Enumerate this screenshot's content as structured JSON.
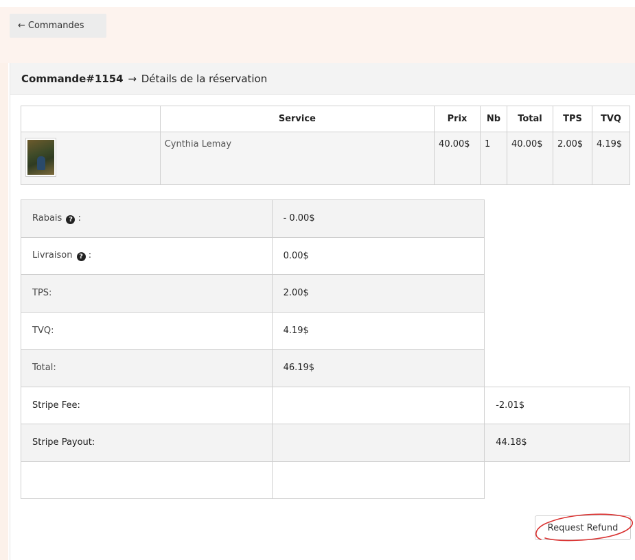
{
  "nav": {
    "back_arrow": "←",
    "back_label": "Commandes"
  },
  "header": {
    "order": "Commande#1154",
    "arrow": "→",
    "subtitle": "Détails de la réservation"
  },
  "services": {
    "headers": [
      "Service",
      "Prix",
      "Nb",
      "Total",
      "TPS",
      "TVQ"
    ],
    "rows": [
      {
        "name": "Cynthia Lemay",
        "prix": "40.00$",
        "nb": "1",
        "total": "40.00$",
        "tps": "2.00$",
        "tvq": "4.19$"
      }
    ]
  },
  "summary": {
    "rabais_label": "Rabais",
    "rabais_suffix": ":",
    "rabais_value": "- 0.00$",
    "livraison_label": "Livraison",
    "livraison_suffix": ":",
    "livraison_value": "0.00$",
    "tps_label": "TPS:",
    "tps_value": "2.00$",
    "tvq_label": "TVQ:",
    "tvq_value": "4.19$",
    "total_label": "Total:",
    "total_value": "46.19$",
    "stripe_fee_label": "Stripe Fee:",
    "stripe_fee_value": "-2.01$",
    "stripe_payout_label": "Stripe Payout:",
    "stripe_payout_value": "44.18$",
    "help_glyph": "?"
  },
  "actions": {
    "refund_label": "Request Refund"
  },
  "colors": {
    "annotation": "#d9302f",
    "page_band": "#fdf3ee",
    "row_grey": "#f3f3f3"
  }
}
